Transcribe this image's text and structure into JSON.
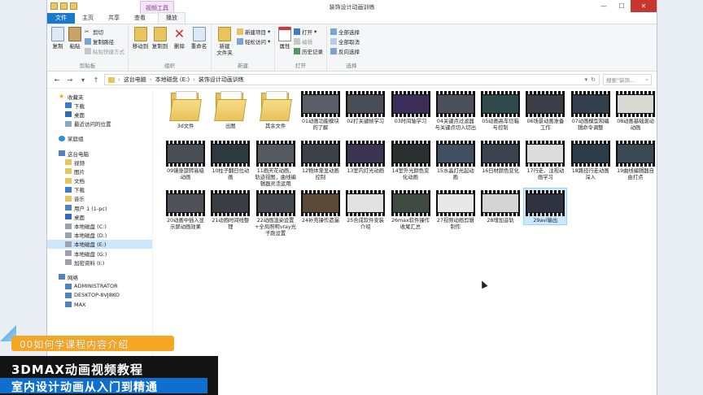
{
  "window": {
    "title": "装饰设计动画训练",
    "context_tab": "视频工具"
  },
  "tabs": [
    {
      "label": "文件"
    },
    {
      "label": "主页"
    },
    {
      "label": "共享"
    },
    {
      "label": "查看"
    },
    {
      "label": "播放"
    }
  ],
  "ribbon": {
    "clipboard": {
      "label": "剪贴板",
      "copy": "复制",
      "paste": "粘贴",
      "cut": "剪切",
      "copy_path": "复制路径",
      "paste_shortcut": "粘贴快捷方式"
    },
    "organize": {
      "label": "组织",
      "move_to": "移动到",
      "copy_to": "复制到",
      "delete": "删除",
      "rename": "重命名"
    },
    "new": {
      "label": "新建",
      "new_folder": "新建\n文件夹",
      "new_item": "新建项目",
      "easy_access": "轻松访问"
    },
    "open": {
      "label": "打开",
      "properties": "属性",
      "open": "打开",
      "edit": "编辑",
      "history": "历史记录"
    },
    "select": {
      "label": "选择",
      "select_all": "全部选择",
      "select_none": "全部取消",
      "invert": "反向选择"
    }
  },
  "address": {
    "crumbs": [
      "这台电脑",
      "本地磁盘 (E:)",
      "装饰设计动画训练"
    ],
    "search_placeholder": "搜索\"装饰..."
  },
  "nav": {
    "favorites": {
      "label": "收藏夹",
      "items": [
        "下载",
        "桌面",
        "最近访问的位置"
      ]
    },
    "homegroup": "家庭组",
    "thispc": {
      "label": "这台电脑",
      "items": [
        "视频",
        "图片",
        "文档",
        "下载",
        "音乐",
        "用户 1 (1-pc)",
        "桌面",
        "本地磁盘 (C:)",
        "本地磁盘 (D:)",
        "本地磁盘 (E:)",
        "本地磁盘 (G:)",
        "加密资料 (I:)"
      ]
    },
    "network": {
      "label": "网络",
      "items": [
        "ADMINISTRATOR",
        "DESKTOP-8VJ8KO",
        "MAX"
      ]
    }
  },
  "files": [
    {
      "name": "3d文件",
      "kind": "folder"
    },
    {
      "name": "出图",
      "kind": "folder"
    },
    {
      "name": "其余文件",
      "kind": "folder"
    },
    {
      "name": "01动画功能模块的了解",
      "kind": "video",
      "tone": "#5a5e66"
    },
    {
      "name": "02打关键帧学习",
      "kind": "video",
      "tone": "#4a4d55"
    },
    {
      "name": "03时间轴学习",
      "kind": "video",
      "tone": "#3a2f5a"
    },
    {
      "name": "04关键点过滤器与关键点切入切出",
      "kind": "video",
      "tone": "#4d5058"
    },
    {
      "name": "05动画高车信箱与控制",
      "kind": "video",
      "tone": "#2e4a4a"
    },
    {
      "name": "06场景动画准备工作",
      "kind": "video",
      "tone": "#3a3f46"
    },
    {
      "name": "07动画模型和编辑命令调整",
      "kind": "video",
      "tone": "#31404c"
    },
    {
      "name": "08动画基础滚动动画",
      "kind": "video",
      "tone": "#d8d8d4"
    },
    {
      "name": "09镜身旋转高级动画",
      "kind": "video",
      "tone": "#4a4f55"
    },
    {
      "name": "10柱子翻日位动画",
      "kind": "video",
      "tone": "#2c3a40"
    },
    {
      "name": "11画天花动画，轨迹视图，曲线编辑器灵活运用",
      "kind": "video",
      "tone": "#545860"
    },
    {
      "name": "12物体渐显动画控制",
      "kind": "video",
      "tone": "#3d4148"
    },
    {
      "name": "13室内灯光动画",
      "kind": "video",
      "tone": "#3b3350"
    },
    {
      "name": "14室外光颜色变化动画",
      "kind": "video",
      "tone": "#2a3030"
    },
    {
      "name": "15水晶灯光起动画",
      "kind": "video",
      "tone": "#405060"
    },
    {
      "name": "16日材颜色变化",
      "kind": "video",
      "tone": "#3c4350"
    },
    {
      "name": "17行走、注视动画学习",
      "kind": "video",
      "tone": "#dcdcdc"
    },
    {
      "name": "18路径行走动画深入",
      "kind": "video",
      "tone": "#2c3b48"
    },
    {
      "name": "19曲线编辑器自由打点",
      "kind": "video",
      "tone": "#3a4a55"
    },
    {
      "name": "20动画中插入显示屏动画效果",
      "kind": "video",
      "tone": "#50505a"
    },
    {
      "name": "21动画时间线整理",
      "kind": "video",
      "tone": "#3a3e44"
    },
    {
      "name": "22动画渲染设置+全局照明vray光子跑设置",
      "kind": "video",
      "tone": "#44484f"
    },
    {
      "name": "24补充操作遗漏",
      "kind": "video",
      "tone": "#5b4a38"
    },
    {
      "name": "25合成软件安装介绍",
      "kind": "video",
      "tone": "#e2e2e2"
    },
    {
      "name": "26max软件操作收尾汇总",
      "kind": "video",
      "tone": "#3e4a42"
    },
    {
      "name": "27视频动画剪辑制作",
      "kind": "video",
      "tone": "#e8e8e8"
    },
    {
      "name": "28增加音轨",
      "kind": "video",
      "tone": "#d4d4d4"
    },
    {
      "name": "29avi输出",
      "kind": "video",
      "tone": "#2f3340",
      "selected": true
    }
  ],
  "overlay": {
    "subtitle": "00如何学课程内容介绍",
    "line1": "3DMAX动画视频教程",
    "line2": "室内设计动画从入门到精通"
  }
}
